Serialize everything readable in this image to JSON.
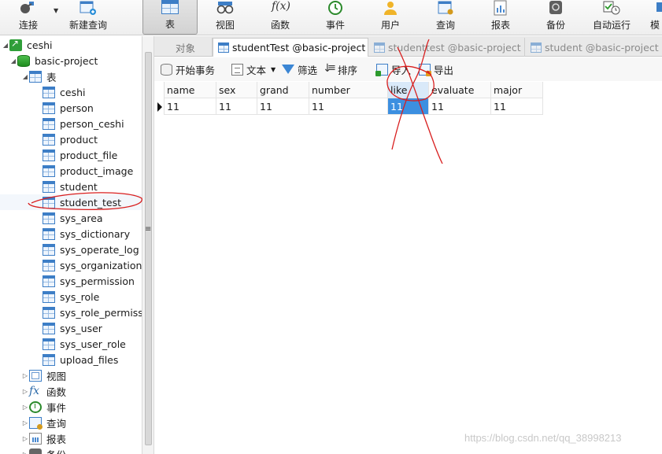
{
  "toolbar": {
    "items": [
      {
        "label": "连接",
        "icon": "connection-icon"
      },
      {
        "label": "新建查询",
        "icon": "new-query-icon"
      },
      {
        "label": "表",
        "icon": "table-icon"
      },
      {
        "label": "视图",
        "icon": "view-icon"
      },
      {
        "label": "函数",
        "icon": "function-icon"
      },
      {
        "label": "事件",
        "icon": "event-icon"
      },
      {
        "label": "用户",
        "icon": "user-icon"
      },
      {
        "label": "查询",
        "icon": "query-icon"
      },
      {
        "label": "报表",
        "icon": "report-icon"
      },
      {
        "label": "备份",
        "icon": "backup-icon"
      },
      {
        "label": "自动运行",
        "icon": "auto-run-icon"
      },
      {
        "label": "模",
        "icon": "model-icon"
      }
    ],
    "function_glyph": "f(x)"
  },
  "tree": {
    "connection": "ceshi",
    "database": "basic-project",
    "tables_group": "表",
    "tables": [
      "ceshi",
      "person",
      "person_ceshi",
      "product",
      "product_file",
      "product_image",
      "student",
      "student_test",
      "sys_area",
      "sys_dictionary",
      "sys_operate_log",
      "sys_organization",
      "sys_permission",
      "sys_role",
      "sys_role_permissi",
      "sys_user",
      "sys_user_role",
      "upload_files"
    ],
    "selected_table": "student_test",
    "groups": [
      "视图",
      "函数",
      "事件",
      "查询",
      "报表",
      "备份"
    ],
    "function_glyph": "fx"
  },
  "tabs": [
    {
      "label": "对象"
    },
    {
      "label": "studentTest @basic-project ..."
    },
    {
      "label": "studenttest @basic-project ..."
    },
    {
      "label": "student @basic-project (c"
    }
  ],
  "subtoolbar": {
    "begin_transaction": "开始事务",
    "text": "文本",
    "filter": "筛选",
    "sort": "排序",
    "import": "导入",
    "export": "导出"
  },
  "grid": {
    "columns": [
      "name",
      "sex",
      "grand",
      "number",
      "like",
      "evaluate",
      "major"
    ],
    "rows": [
      [
        "11",
        "11",
        "11",
        "11",
        "11",
        "11",
        "11"
      ]
    ],
    "selected_column": "like"
  },
  "watermark": "https://blog.csdn.net/qq_38998213",
  "colors": {
    "selection": "#3c8fe0",
    "annotation": "#d81e1e",
    "table_icon": "#3d7ec6"
  }
}
